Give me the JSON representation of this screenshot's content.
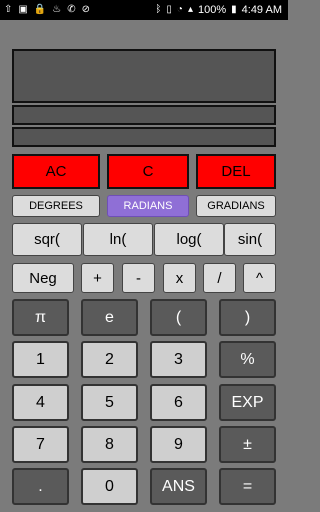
{
  "status_bar": {
    "left_icons": [
      "up-arrow-icon",
      "photo-icon",
      "lock-icon",
      "fire-icon",
      "missed-call-icon",
      "no-sim-icon"
    ],
    "right_icons": [
      "bluetooth-icon",
      "vibrate-icon",
      "wifi-icon",
      "signal-icon"
    ],
    "battery": "100%",
    "battery_icon": "battery-full-icon",
    "time": "4:49 AM"
  },
  "display": {
    "main": "",
    "line2": "",
    "line3": ""
  },
  "buttons": {
    "ac": "AC",
    "c": "C",
    "del": "DEL",
    "degrees": "DEGREES",
    "radians": "RADIANS",
    "gradians": "GRADIANS",
    "sqr": "sqr(",
    "ln": "ln(",
    "log": "log(",
    "sin": "sin(",
    "neg": "Neg",
    "plus": "+",
    "minus": "-",
    "times": "x",
    "divide": "/",
    "power": "^",
    "pi": "π",
    "e": "e",
    "lparen": "(",
    "rparen": ")",
    "one": "1",
    "two": "2",
    "three": "3",
    "percent": "%",
    "four": "4",
    "five": "5",
    "six": "6",
    "exp": "EXP",
    "seven": "7",
    "eight": "8",
    "nine": "9",
    "plusminus": "±",
    "dot": ".",
    "zero": "0",
    "ans": "ANS",
    "equals": "="
  },
  "colors": {
    "red": "#ff0000",
    "accent": "#8f6fd6",
    "dark_key": "#5a5a5a",
    "light_key": "#cfcfcf"
  },
  "selected_angle_mode": "RADIANS"
}
